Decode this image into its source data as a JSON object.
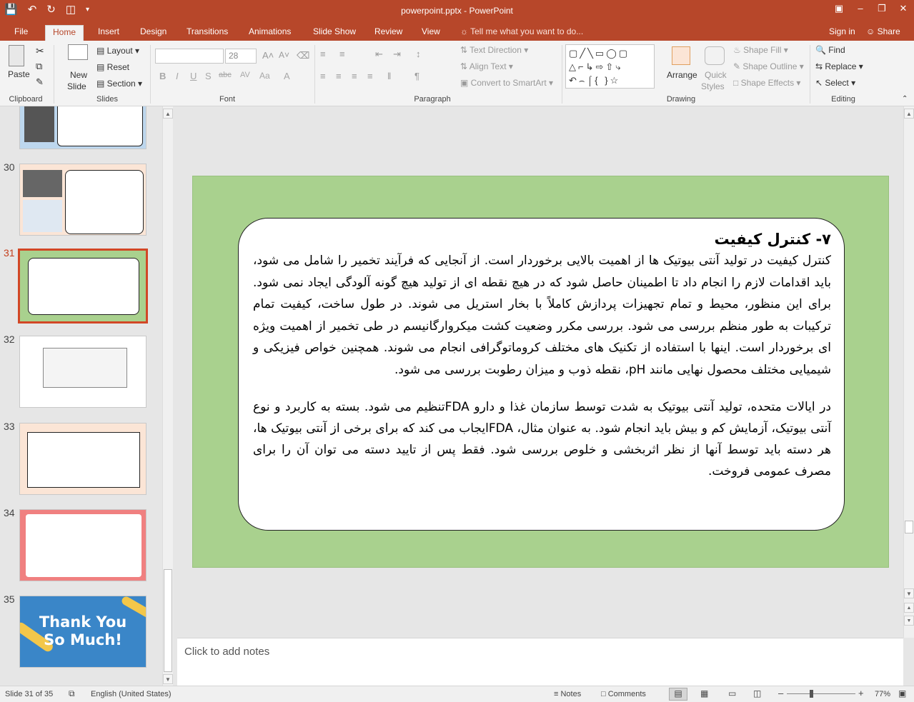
{
  "window": {
    "title": "powerpoint.pptx - PowerPoint",
    "qat": {
      "save_icon": "save-icon",
      "undo_icon": "undo-icon",
      "redo_icon": "redo-icon",
      "present_icon": "present-from-beginning-icon"
    },
    "controls": {
      "ribbon_options": "ribbon-display-options-icon",
      "minimize": "minimize-icon",
      "restore": "restore-icon",
      "close": "close-icon"
    }
  },
  "tabs": {
    "file": "File",
    "home": "Home",
    "insert": "Insert",
    "design": "Design",
    "transitions": "Transitions",
    "animations": "Animations",
    "slideshow": "Slide Show",
    "review": "Review",
    "view": "View",
    "tell_me": "Tell me what you want to do...",
    "sign_in": "Sign in",
    "share": "Share"
  },
  "ribbon": {
    "clipboard": {
      "paste": "Paste",
      "label": "Clipboard"
    },
    "slides": {
      "new_slide_1": "New",
      "new_slide_2": "Slide",
      "layout": "Layout",
      "reset": "Reset",
      "section": "Section",
      "label": "Slides"
    },
    "font": {
      "font_name": "",
      "font_size": "28",
      "label": "Font"
    },
    "paragraph": {
      "text_direction": "Text Direction",
      "align_text": "Align Text",
      "convert_smartart": "Convert to SmartArt",
      "label": "Paragraph"
    },
    "drawing": {
      "arrange": "Arrange",
      "quick_styles_1": "Quick",
      "quick_styles_2": "Styles",
      "shape_fill": "Shape Fill",
      "shape_outline": "Shape Outline",
      "shape_effects": "Shape Effects",
      "label": "Drawing"
    },
    "editing": {
      "find": "Find",
      "replace": "Replace",
      "select": "Select",
      "label": "Editing"
    }
  },
  "thumbnails": [
    {
      "number": "",
      "bg": "#bdd7ee"
    },
    {
      "number": "30",
      "bg": "#fbe5d6"
    },
    {
      "number": "31",
      "bg": "#a9d18e",
      "selected": true
    },
    {
      "number": "32",
      "bg": "#ffffff"
    },
    {
      "number": "33",
      "bg": "#fbe5d6"
    },
    {
      "number": "34",
      "bg": "#f08080"
    },
    {
      "number": "35",
      "bg": "#3a86c8"
    }
  ],
  "thumb35": {
    "line1": "Thank You",
    "line2": "So Much!"
  },
  "slide": {
    "title": "۷- کنترل کیفیت",
    "paragraph1": "کنترل کیفیت در تولید آنتی بیوتیک ها از اهمیت بالایی برخوردار است. از آنجایی که فرآیند تخمیر را شامل می شود، باید اقدامات لازم را انجام داد تا اطمینان حاصل شود که در هیچ نقطه ای از تولید هیچ گونه آلودگی ایجاد نمی شود. برای این منظور، محیط و تمام تجهیزات پردازش کاملاً با بخار استریل می شوند. در طول ساخت، کیفیت تمام ترکیبات به طور منظم بررسی می شود. بررسی مکرر وضعیت کشت میکروارگانیسم در طی تخمیر از اهمیت ویژه ای برخوردار است. اینها با استفاده از تکنیک های مختلف کروماتوگرافی انجام می شوند. همچنین خواص فیزیکی و شیمیایی مختلف محصول نهایی مانند pH، نقطه ذوب و میزان رطوبت بررسی می شود.",
    "paragraph2": "در ایالات متحده، تولید آنتی بیوتیک به شدت توسط سازمان غذا و دارو FDAتنظیم می شود. بسته به کاربرد و نوع آنتی بیوتیک، آزمایش کم و بیش باید انجام شود. به عنوان مثال، FDAایجاب می کند که برای برخی از آنتی بیوتیک ها، هر دسته باید توسط آنها از نظر اثربخشی و خلوص بررسی شود. فقط پس از تایید دسته می توان آن را برای مصرف عمومی فروخت."
  },
  "notes": {
    "placeholder": "Click to add notes"
  },
  "status": {
    "slide_info": "Slide 31 of 35",
    "language": "English (United States)",
    "notes": "Notes",
    "comments": "Comments",
    "zoom": "77%"
  }
}
